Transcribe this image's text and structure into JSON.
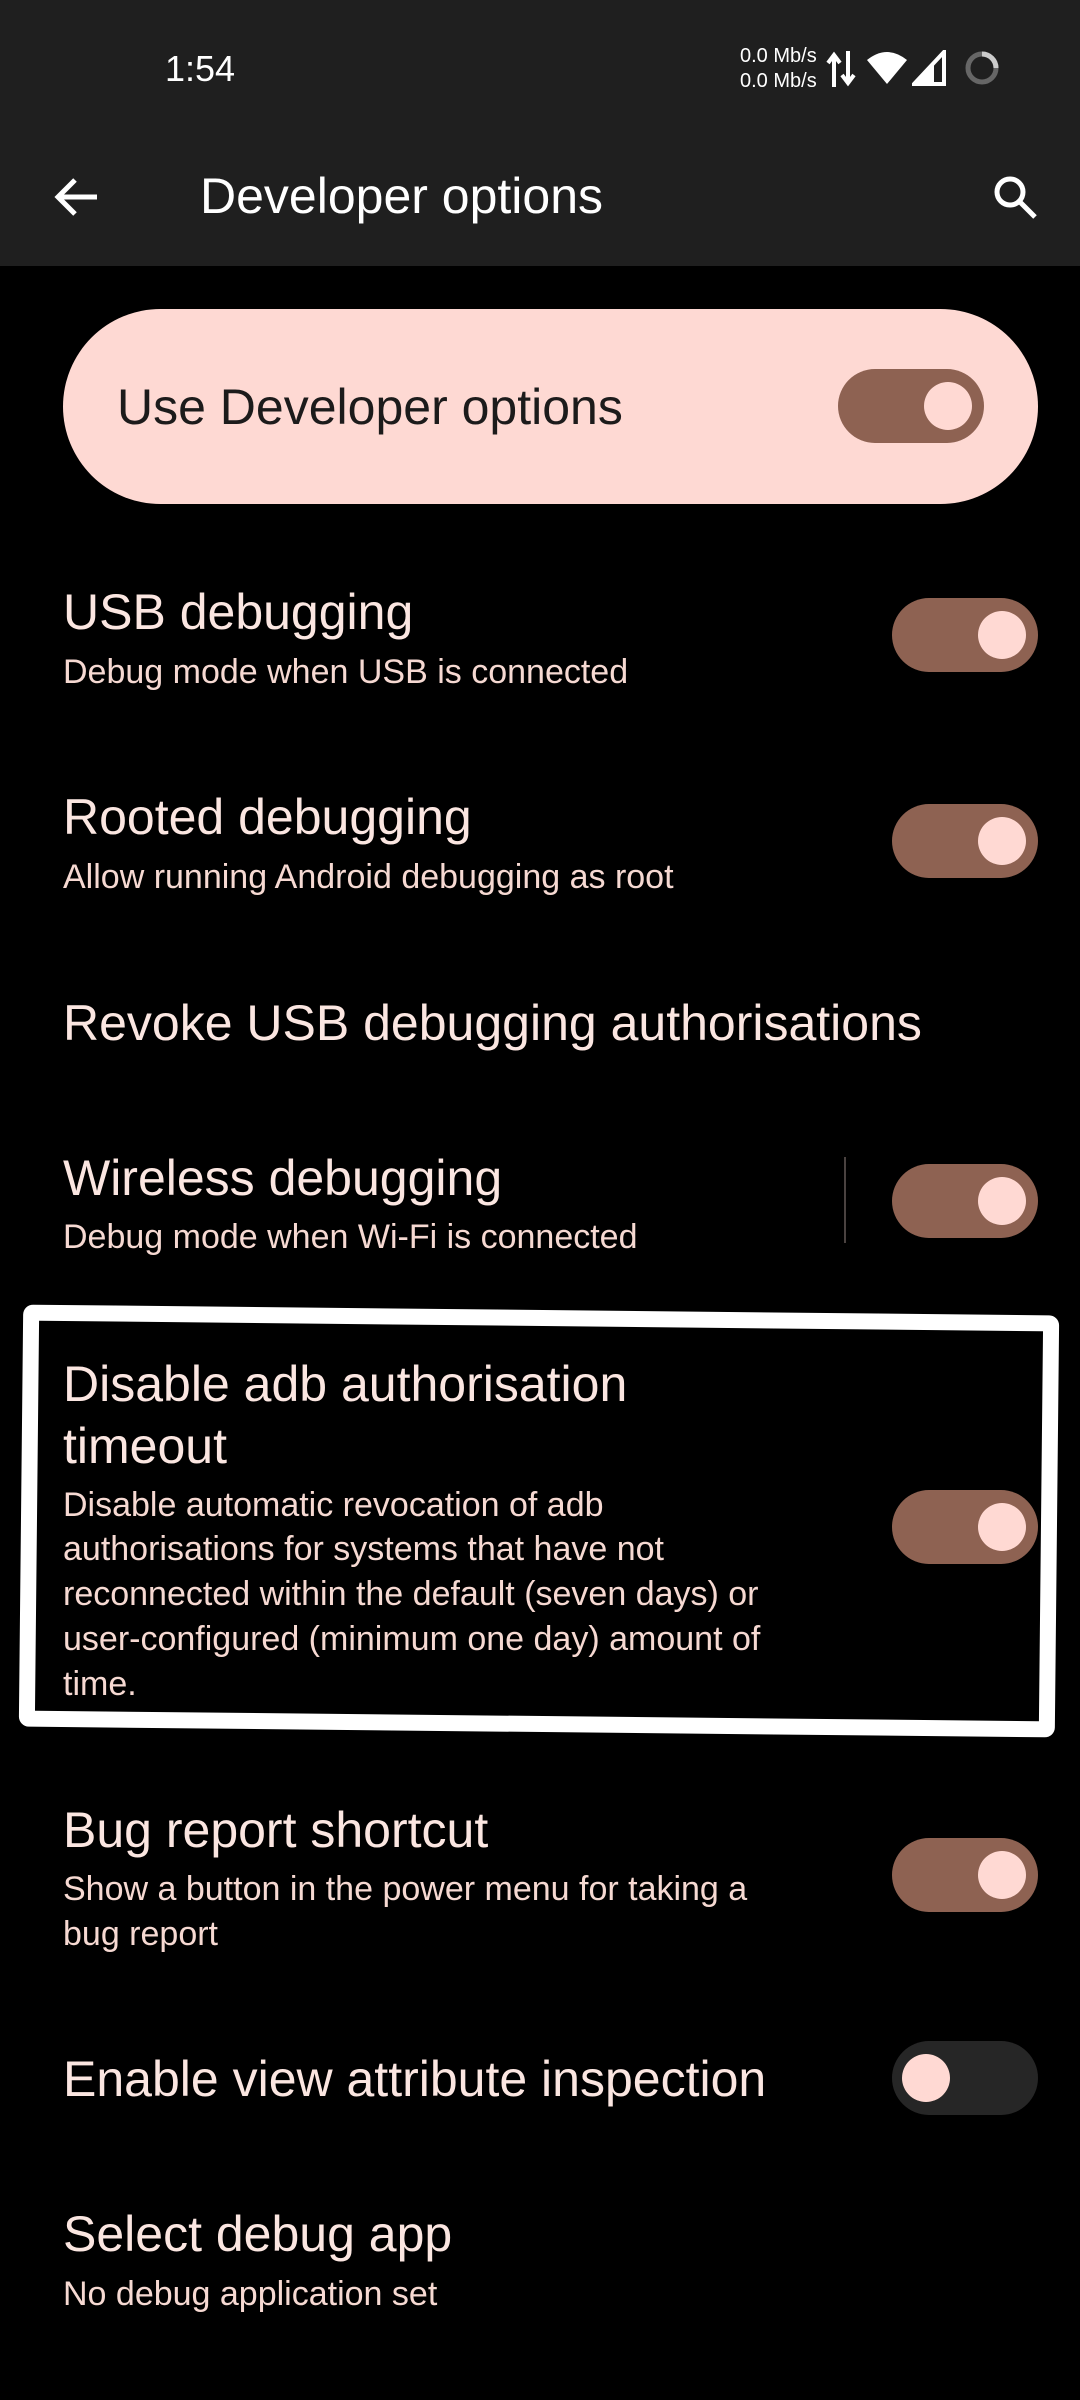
{
  "status_bar": {
    "time": "1:54",
    "net_up": "0.0 Mb/s",
    "net_down": "0.0 Mb/s",
    "icons": [
      "data-arrows-icon",
      "wifi-icon",
      "signal-icon",
      "loading-circle-icon"
    ]
  },
  "app_bar": {
    "title": "Developer options",
    "back_icon": "arrow-back-icon",
    "search_icon": "search-icon"
  },
  "master_switch": {
    "label": "Use Developer options",
    "state": "on"
  },
  "preferences": [
    {
      "title": "USB debugging",
      "summary": "Debug mode when USB is connected",
      "toggle": "on"
    },
    {
      "title": "Rooted debugging",
      "summary": "Allow running Android debugging as root",
      "toggle": "on"
    },
    {
      "title": "Revoke USB debugging authorisations"
    },
    {
      "title": "Wireless debugging",
      "summary": "Debug mode when Wi-Fi is connected",
      "toggle": "on"
    },
    {
      "title_line1": "Disable adb authorisation",
      "title_line2": "timeout",
      "summary_lines": [
        "Disable automatic revocation of adb",
        "authorisations for systems that have not",
        "reconnected within the default (seven days) or",
        "user-configured (minimum one day) amount of",
        "time."
      ],
      "toggle": "on"
    },
    {
      "title": "Bug report shortcut",
      "summary_lines": [
        "Show a button in the power menu for taking a",
        "bug report"
      ],
      "toggle": "on"
    },
    {
      "title": "Enable view attribute inspection",
      "toggle": "off"
    },
    {
      "title": "Select debug app",
      "summary": "No debug application set"
    }
  ],
  "colors": {
    "background": "#000000",
    "bar": "#1f1f1f",
    "card": "#fed9d3",
    "toggle_on_track": "#8e6252",
    "toggle_off_track": "#262626",
    "knob": "#ffd9d3",
    "highlight": "#ffffff"
  }
}
